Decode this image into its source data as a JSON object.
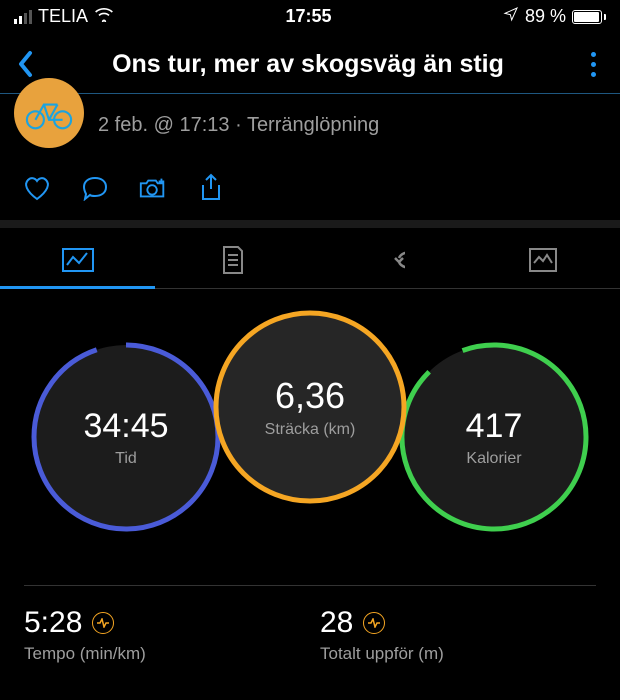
{
  "status": {
    "carrier": "TELIA",
    "time": "17:55",
    "battery_pct": "89 %"
  },
  "nav": {
    "title": "Ons tur, mer av skogsväg än stig"
  },
  "activity": {
    "timestamp": "2 feb. @ 17:13",
    "type": "Terränglöpning"
  },
  "circles": {
    "distance": {
      "value": "6,36",
      "label": "Sträcka (km)"
    },
    "time": {
      "value": "34:45",
      "label": "Tid"
    },
    "calories": {
      "value": "417",
      "label": "Kalorier"
    }
  },
  "stats": {
    "pace": {
      "value": "5:28",
      "label": "Tempo (min/km)"
    },
    "ascent": {
      "value": "28",
      "label": "Totalt uppför (m)"
    }
  }
}
